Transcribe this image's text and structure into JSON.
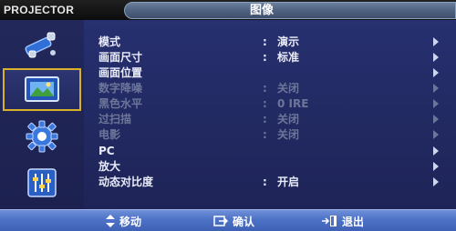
{
  "header": {
    "brand": "PROJECTOR",
    "title": "图像"
  },
  "sidebar": {
    "items": [
      {
        "name": "input",
        "icon": "input-source-icon",
        "selected": false
      },
      {
        "name": "picture",
        "icon": "picture-icon",
        "selected": true
      },
      {
        "name": "setup",
        "icon": "gear-icon",
        "selected": false
      },
      {
        "name": "option",
        "icon": "sliders-icon",
        "selected": false
      }
    ]
  },
  "menu": {
    "items": [
      {
        "label": "模式",
        "value": "演示",
        "enabled": true
      },
      {
        "label": "画面尺寸",
        "value": "标准",
        "enabled": true
      },
      {
        "label": "画面位置",
        "value": "",
        "enabled": true
      },
      {
        "label": "数字降噪",
        "value": "关闭",
        "enabled": false
      },
      {
        "label": "黑色水平",
        "value": "0 IRE",
        "enabled": false
      },
      {
        "label": "过扫描",
        "value": "关闭",
        "enabled": false
      },
      {
        "label": "电影",
        "value": "关闭",
        "enabled": false
      },
      {
        "label": "PC",
        "value": "",
        "enabled": true
      },
      {
        "label": "放大",
        "value": "",
        "enabled": true
      },
      {
        "label": "动态对比度",
        "value": "开启",
        "enabled": true
      }
    ],
    "colon": ":"
  },
  "footer": {
    "move": "移动",
    "enter": "确认",
    "exit": "退出"
  },
  "colors": {
    "selection_border": "#d8b12b",
    "bottom_bar": "#4d72c6",
    "enabled_text": "#e9ecf8",
    "disabled_text": "#6d7698"
  }
}
